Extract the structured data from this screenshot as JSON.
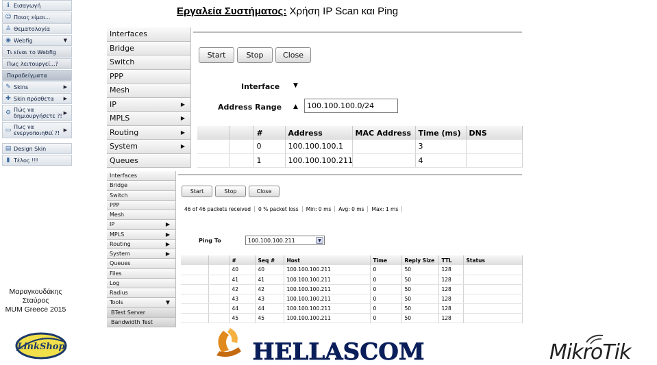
{
  "heading": {
    "bold": "Εργαλεία Συστήματος:",
    "rest": " Χρήση IP Scan και Ping"
  },
  "sidebar": [
    {
      "label": "Εισαγωγή",
      "icon": "info-icon",
      "type": "top"
    },
    {
      "label": "Ποιος είμαι...",
      "icon": "user-icon",
      "type": "top"
    },
    {
      "label": "Θεματολογία",
      "icon": "topics-icon",
      "type": "top"
    },
    {
      "label": "Webfig",
      "icon": "globe-icon",
      "type": "top",
      "arrow": "▼"
    },
    {
      "label": "Τι είναι το Webfig",
      "type": "sub"
    },
    {
      "label": "Πως λειτουργεί...?",
      "type": "sub"
    },
    {
      "label": "Παραδείγματα",
      "type": "sub-active"
    },
    {
      "label": "Skins",
      "icon": "brush-icon",
      "type": "top",
      "arrow": "▶"
    },
    {
      "label": "Skin πρόσθετα",
      "icon": "puzzle-icon",
      "type": "top",
      "arrow": "▶"
    },
    {
      "label": "Πώς να δημιουργήσετε ?!",
      "icon": "gear-icon",
      "type": "tall",
      "arrow": "▶"
    },
    {
      "label": "Πως να ενεργοποιηθεί ?!",
      "icon": "monitor-icon",
      "type": "tall",
      "arrow": "▶"
    },
    {
      "label": "Design Skin",
      "icon": "design-icon",
      "type": "top"
    },
    {
      "label": "Τέλος !!!",
      "icon": "book-icon",
      "type": "top"
    }
  ],
  "author": {
    "line1": "Μαραγκουδάκης",
    "line2": "Σταύρος",
    "line3": "MUM Greece 2015"
  },
  "ipscan": {
    "menu": [
      {
        "label": "Interfaces",
        "arrow": ""
      },
      {
        "label": "Bridge",
        "arrow": ""
      },
      {
        "label": "Switch",
        "arrow": ""
      },
      {
        "label": "PPP",
        "arrow": ""
      },
      {
        "label": "Mesh",
        "arrow": ""
      },
      {
        "label": "IP",
        "arrow": "▶"
      },
      {
        "label": "MPLS",
        "arrow": "▶"
      },
      {
        "label": "Routing",
        "arrow": "▶"
      },
      {
        "label": "System",
        "arrow": "▶"
      },
      {
        "label": "Queues",
        "arrow": ""
      }
    ],
    "buttons": {
      "start": "Start",
      "stop": "Stop",
      "close": "Close"
    },
    "interface_label": "Interface",
    "address_range_label": "Address Range",
    "address_range_value": "100.100.100.0/24",
    "columns": [
      "",
      "",
      "#",
      "Address",
      "MAC Address",
      "Time (ms)",
      "DNS"
    ],
    "rows": [
      [
        "",
        "",
        "0",
        "100.100.100.1",
        "",
        "3",
        ""
      ],
      [
        "",
        "",
        "1",
        "100.100.100.211",
        "",
        "4",
        ""
      ]
    ]
  },
  "ping": {
    "menu": [
      {
        "label": "Interfaces",
        "arrow": "",
        "sub": false
      },
      {
        "label": "Bridge",
        "arrow": "",
        "sub": false
      },
      {
        "label": "Switch",
        "arrow": "",
        "sub": false
      },
      {
        "label": "PPP",
        "arrow": "",
        "sub": false
      },
      {
        "label": "Mesh",
        "arrow": "",
        "sub": false
      },
      {
        "label": "IP",
        "arrow": "▶",
        "sub": false
      },
      {
        "label": "MPLS",
        "arrow": "▶",
        "sub": false
      },
      {
        "label": "Routing",
        "arrow": "▶",
        "sub": false
      },
      {
        "label": "System",
        "arrow": "▶",
        "sub": false
      },
      {
        "label": "Queues",
        "arrow": "",
        "sub": false
      },
      {
        "label": "Files",
        "arrow": "",
        "sub": false
      },
      {
        "label": "Log",
        "arrow": "",
        "sub": false
      },
      {
        "label": "Radius",
        "arrow": "",
        "sub": false
      },
      {
        "label": "Tools",
        "arrow": "▼",
        "sub": false
      },
      {
        "label": "BTest Server",
        "arrow": "",
        "sub": true
      },
      {
        "label": "Bandwidth Test",
        "arrow": "",
        "sub": true
      }
    ],
    "buttons": {
      "start": "Start",
      "stop": "Stop",
      "close": "Close"
    },
    "stats": [
      "46 of 46 packets received",
      "0 % packet loss",
      "Min: 0 ms",
      "Avg: 0 ms",
      "Max: 1 ms"
    ],
    "ping_to_label": "Ping To",
    "ping_to_value": "100.100.100.211",
    "columns": [
      "",
      "",
      "#",
      "Seq #",
      "Host",
      "Time",
      "Reply Size",
      "TTL",
      "Status"
    ],
    "rows": [
      [
        "",
        "",
        "40",
        "40",
        "100.100.100.211",
        "0",
        "50",
        "128",
        ""
      ],
      [
        "",
        "",
        "41",
        "41",
        "100.100.100.211",
        "0",
        "50",
        "128",
        ""
      ],
      [
        "",
        "",
        "42",
        "42",
        "100.100.100.211",
        "0",
        "50",
        "128",
        ""
      ],
      [
        "",
        "",
        "43",
        "43",
        "100.100.100.211",
        "0",
        "50",
        "128",
        ""
      ],
      [
        "",
        "",
        "44",
        "44",
        "100.100.100.211",
        "0",
        "50",
        "128",
        ""
      ],
      [
        "",
        "",
        "45",
        "45",
        "100.100.100.211",
        "0",
        "50",
        "128",
        ""
      ]
    ]
  },
  "logos": {
    "linkshop": "LinkShop",
    "hellascom": "HELLASCOM",
    "mikrotik": "MikroTik"
  }
}
